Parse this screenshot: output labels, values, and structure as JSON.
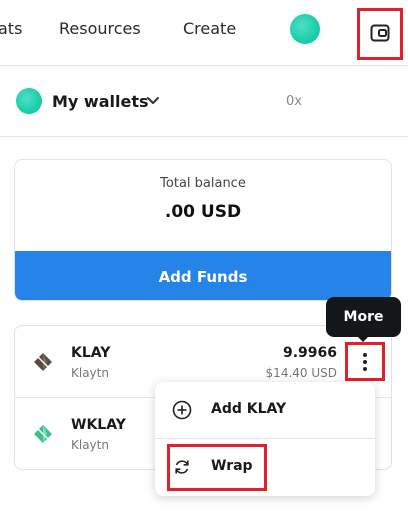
{
  "nav": {
    "links": [
      "ats",
      "Resources",
      "Create"
    ]
  },
  "wallet": {
    "name": "My wallets",
    "address": "0x"
  },
  "balance": {
    "label": "Total balance",
    "value": ".00 USD",
    "add_funds_label": "Add Funds"
  },
  "tokens": [
    {
      "symbol": "KLAY",
      "network": "Klaytn",
      "amount": "9.9966",
      "fiat": "$14.40 USD",
      "icon": "klay-logo-icon"
    },
    {
      "symbol": "WKLAY",
      "network": "Klaytn",
      "amount": "",
      "fiat": "",
      "icon": "wklay-logo-icon"
    }
  ],
  "tooltip": {
    "label": "More"
  },
  "menu": {
    "items": [
      {
        "label": "Add KLAY",
        "icon": "add-circle-icon"
      },
      {
        "label": "Wrap",
        "icon": "swap-arrows-icon"
      }
    ]
  },
  "colors": {
    "accent": "#2684e8",
    "highlight": "#e0202a",
    "avatar": "#1fcfaa",
    "tooltip_bg": "#14171a"
  }
}
